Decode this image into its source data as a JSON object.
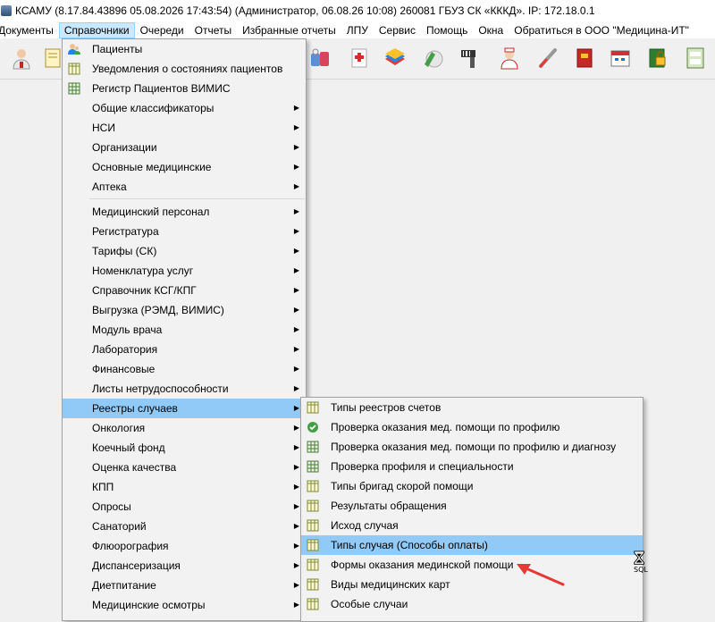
{
  "window": {
    "title": "КСАМУ (8.17.84.43896 05.08.2026 17:43:54) (Администратор, 06.08.26 10:08)  260081 ГБУЗ СК «КККД». IP: 172.18.0.1"
  },
  "menubar": {
    "items": [
      "Документы",
      "Справочники",
      "Очереди",
      "Отчеты",
      "Избранные отчеты",
      "ЛПУ",
      "Сервис",
      "Помощь",
      "Окна",
      "Обратиться в ООО \"Медицина-ИТ\""
    ]
  },
  "toolbar": {
    "icons": [
      "doctor-icon",
      "notebook-icon",
      "pills-icon",
      "first-aid-kit-icon",
      "books-icon",
      "capsules-icon",
      "barcode-scanner-icon",
      "nurse-icon",
      "thermometer-icon",
      "red-book-icon",
      "calendar-icon",
      "lock-book-icon",
      "mkb-10-icon"
    ]
  },
  "menu_main": {
    "items": [
      {
        "label": "Пациенты",
        "icon": "patients-icon",
        "submenu": false
      },
      {
        "label": "Уведомления о состояниях пациентов",
        "icon": "table-icon",
        "submenu": false
      },
      {
        "label": "Регистр Пациентов ВИМИС",
        "icon": "grid-icon",
        "submenu": false
      },
      {
        "label": "Общие классификаторы",
        "submenu": true
      },
      {
        "label": "НСИ",
        "submenu": true
      },
      {
        "label": "Организации",
        "submenu": true
      },
      {
        "label": "Основные медицинские",
        "submenu": true
      },
      {
        "label": "Аптека",
        "submenu": true
      },
      {
        "label": "Медицинский персонал",
        "submenu": true
      },
      {
        "label": "Регистратура",
        "submenu": true
      },
      {
        "label": "Тарифы (СК)",
        "submenu": true
      },
      {
        "label": "Номенклатура услуг",
        "submenu": true
      },
      {
        "label": "Справочник КСГ/КПГ",
        "submenu": true
      },
      {
        "label": "Выгрузка (РЭМД, ВИМИС)",
        "submenu": true
      },
      {
        "label": "Модуль врача",
        "submenu": true
      },
      {
        "label": "Лаборатория",
        "submenu": true
      },
      {
        "label": "Финансовые",
        "submenu": true
      },
      {
        "label": "Листы нетрудоспособности",
        "submenu": true
      },
      {
        "label": "Реестры случаев",
        "submenu": true
      },
      {
        "label": "Онкология",
        "submenu": true
      },
      {
        "label": "Коечный фонд",
        "submenu": true
      },
      {
        "label": "Оценка качества",
        "submenu": true
      },
      {
        "label": "КПП",
        "submenu": true
      },
      {
        "label": "Опросы",
        "submenu": true
      },
      {
        "label": "Санаторий",
        "submenu": true
      },
      {
        "label": "Флюорография",
        "submenu": true
      },
      {
        "label": "Диспансеризация",
        "submenu": true
      },
      {
        "label": "Диетпитание",
        "submenu": true
      },
      {
        "label": "Медицинские осмотры",
        "submenu": true
      }
    ]
  },
  "menu_sub": {
    "items": [
      {
        "label": "Типы реестров счетов",
        "icon": "table-icon"
      },
      {
        "label": "Проверка оказания мед. помощи по профилю",
        "icon": "check-circle-icon"
      },
      {
        "label": "Проверка оказания мед. помощи по профилю и диагнозу",
        "icon": "grid-icon"
      },
      {
        "label": "Проверка профиля и специальности",
        "icon": "grid-icon"
      },
      {
        "label": "Типы бригад скорой помощи",
        "icon": "table-icon"
      },
      {
        "label": "Результаты обращения",
        "icon": "table-icon"
      },
      {
        "label": "Исход случая",
        "icon": "table-icon"
      },
      {
        "label": "Типы случая (Способы оплаты)",
        "icon": "table-icon"
      },
      {
        "label": "Формы оказания мединской помощи",
        "icon": "table-icon"
      },
      {
        "label": "Виды медицинских карт",
        "icon": "table-icon"
      },
      {
        "label": "Особые случаи",
        "icon": "table-icon"
      }
    ]
  },
  "cursor": {
    "label": "SQL"
  },
  "colors": {
    "highlight": "#91c9f7",
    "menu_active": "#cce8ff",
    "annotation_arrow": "#e53935"
  }
}
